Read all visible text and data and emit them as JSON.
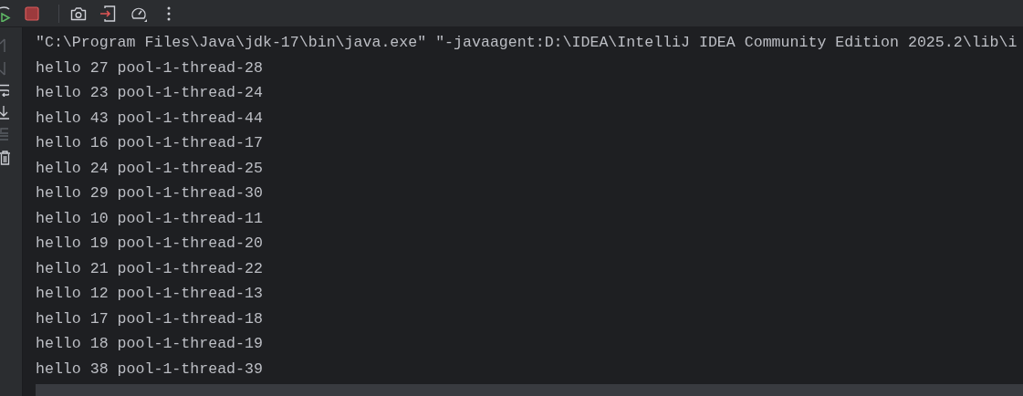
{
  "console": {
    "command": "\"C:\\Program Files\\Java\\jdk-17\\bin\\java.exe\" \"-javaagent:D:\\IDEA\\IntelliJ IDEA Community Edition 2025.2\\lib\\i",
    "lines": [
      "hello 27 pool-1-thread-28",
      "hello 23 pool-1-thread-24",
      "hello 43 pool-1-thread-44",
      "hello 16 pool-1-thread-17",
      "hello 24 pool-1-thread-25",
      "hello 29 pool-1-thread-30",
      "hello 10 pool-1-thread-11",
      "hello 19 pool-1-thread-20",
      "hello 21 pool-1-thread-22",
      "hello 12 pool-1-thread-13",
      "hello 17 pool-1-thread-18",
      "hello 18 pool-1-thread-19",
      "hello 38 pool-1-thread-39"
    ]
  }
}
